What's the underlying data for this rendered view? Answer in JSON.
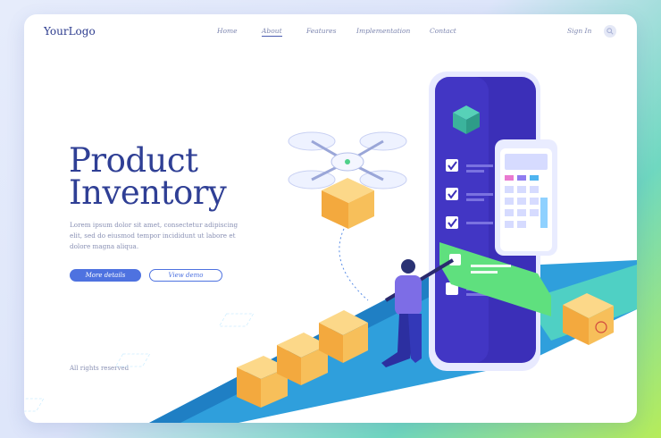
{
  "header": {
    "logo": "YourLogo",
    "nav": [
      {
        "label": "Home"
      },
      {
        "label": "About",
        "active": true
      },
      {
        "label": "Features"
      },
      {
        "label": "Implementation"
      },
      {
        "label": "Contact"
      }
    ],
    "signin": "Sign In",
    "search_icon": "search-icon"
  },
  "hero": {
    "title_line1": "Product",
    "title_line2": "Inventory",
    "description": "Lorem ipsum dolor sit amet, consectetur adipiscing elit, sed do eiusmod tempor incididunt ut labore et dolore magna aliqua.",
    "primary_button": "More details",
    "secondary_button": "View demo"
  },
  "footer": {
    "rights": "All rights reserved"
  },
  "colors": {
    "accent": "#4e72e0",
    "title": "#2f3f95",
    "phone_screen": "#3b2fb8",
    "box": "#f5b848",
    "belt": "#3aa6dd"
  }
}
